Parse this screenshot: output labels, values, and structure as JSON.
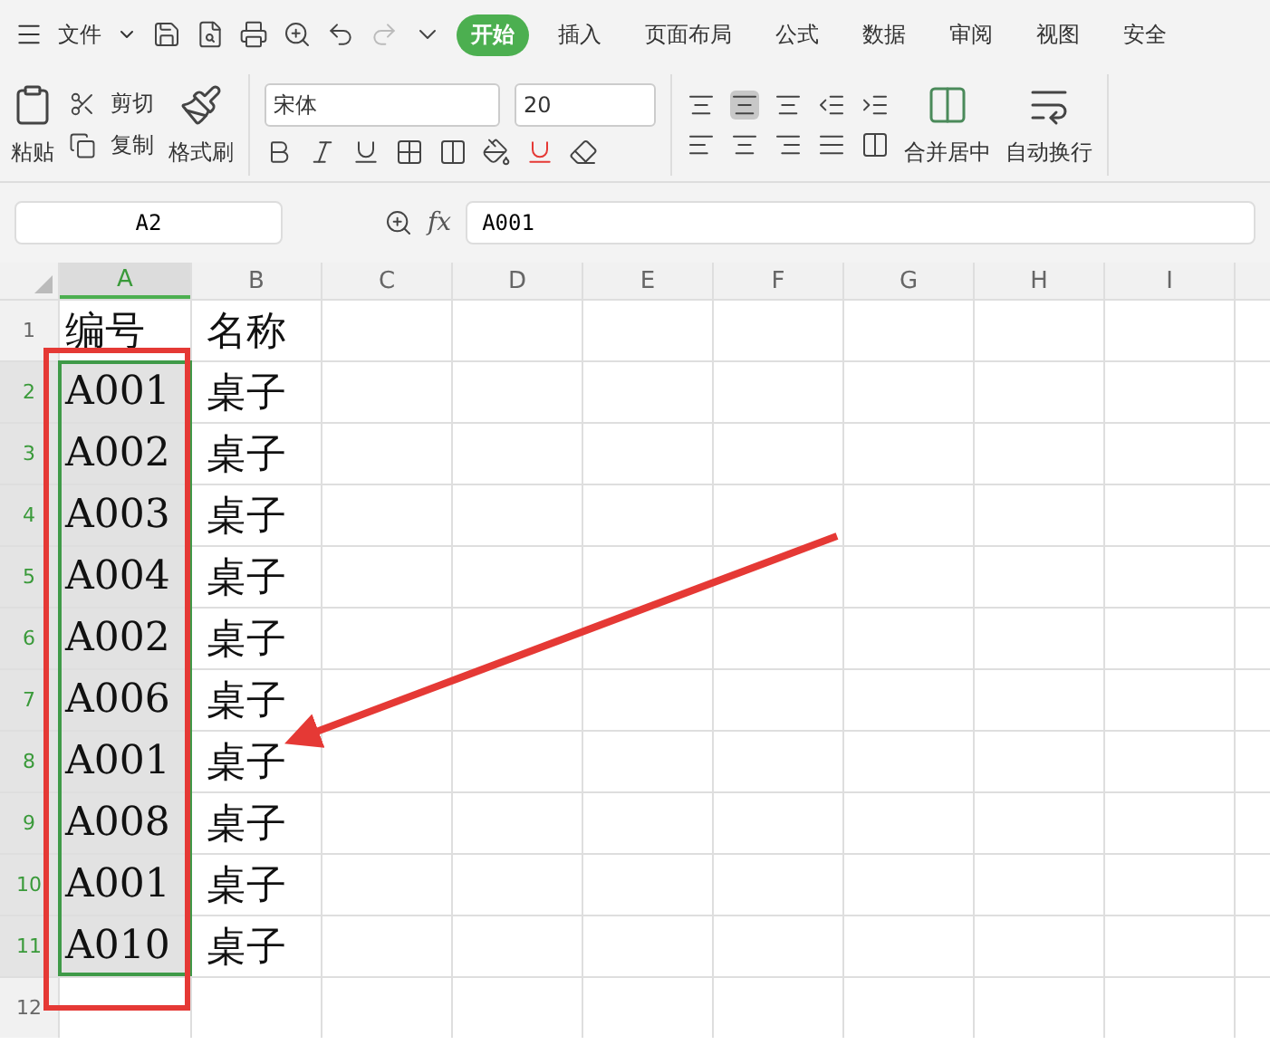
{
  "menu": {
    "label": "文件"
  },
  "tabs": [
    {
      "label": "开始",
      "selected": true
    },
    {
      "label": "插入",
      "selected": false
    },
    {
      "label": "页面布局",
      "selected": false
    },
    {
      "label": "公式",
      "selected": false
    },
    {
      "label": "数据",
      "selected": false
    },
    {
      "label": "审阅",
      "selected": false
    },
    {
      "label": "视图",
      "selected": false
    },
    {
      "label": "安全",
      "selected": false
    }
  ],
  "ribbon": {
    "paste": "粘贴",
    "cut": "剪切",
    "copy": "复制",
    "format_painter": "格式刷",
    "font_name": "宋体",
    "font_size": "20",
    "merge": "合并居中",
    "wrap": "自动换行"
  },
  "formula_bar": {
    "cell_ref": "A2",
    "fx": "fx",
    "value": "A001"
  },
  "columns": [
    {
      "label": "A",
      "selected": true
    },
    {
      "label": "B",
      "selected": false
    },
    {
      "label": "C",
      "selected": false
    },
    {
      "label": "D",
      "selected": false
    },
    {
      "label": "E",
      "selected": false
    },
    {
      "label": "F",
      "selected": false
    },
    {
      "label": "G",
      "selected": false
    },
    {
      "label": "H",
      "selected": false
    },
    {
      "label": "I",
      "selected": false
    }
  ],
  "rows": [
    {
      "number": "1",
      "selected": false,
      "cells": [
        "编号",
        "名称"
      ]
    },
    {
      "number": "2",
      "selected": true,
      "cells": [
        "A001",
        "桌子"
      ]
    },
    {
      "number": "3",
      "selected": true,
      "cells": [
        "A002",
        "桌子"
      ]
    },
    {
      "number": "4",
      "selected": true,
      "cells": [
        "A003",
        "桌子"
      ]
    },
    {
      "number": "5",
      "selected": true,
      "cells": [
        "A004",
        "桌子"
      ]
    },
    {
      "number": "6",
      "selected": true,
      "cells": [
        "A002",
        "桌子"
      ]
    },
    {
      "number": "7",
      "selected": true,
      "cells": [
        "A006",
        "桌子"
      ]
    },
    {
      "number": "8",
      "selected": true,
      "cells": [
        "A001",
        "桌子"
      ]
    },
    {
      "number": "9",
      "selected": true,
      "cells": [
        "A008",
        "桌子"
      ]
    },
    {
      "number": "10",
      "selected": true,
      "cells": [
        "A001",
        "桌子"
      ]
    },
    {
      "number": "11",
      "selected": true,
      "cells": [
        "A010",
        "桌子"
      ]
    },
    {
      "number": "12",
      "selected": false,
      "cells": []
    }
  ]
}
